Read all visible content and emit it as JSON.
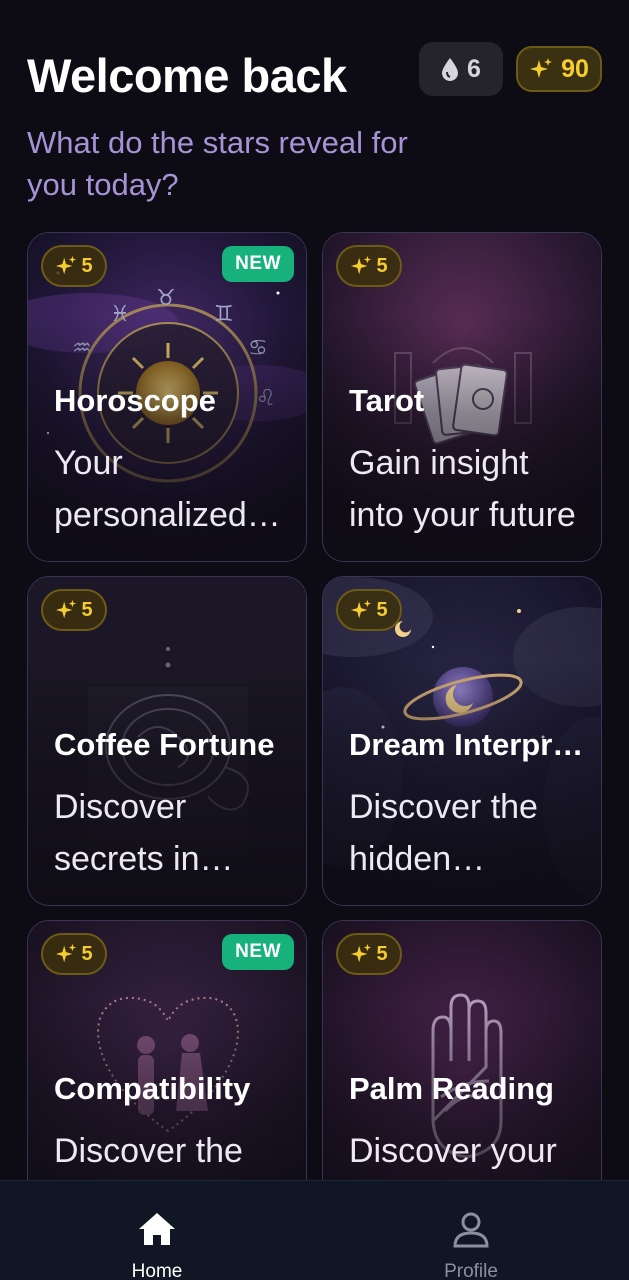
{
  "header": {
    "title": "Welcome back",
    "subtitle": "What do the stars reveal for you today?",
    "drops_count": "6",
    "stars_count": "90"
  },
  "cards": [
    {
      "title": "Horoscope",
      "description": "Your personalized horoscope",
      "cost": "5",
      "badge": "NEW",
      "icon": "zodiac-wheel-icon"
    },
    {
      "title": "Tarot",
      "description": "Gain insight into your future",
      "cost": "5",
      "badge": "",
      "icon": "tarot-cards-icon"
    },
    {
      "title": "Coffee Fortune",
      "description": "Discover secrets in Turkish coffee",
      "cost": "5",
      "badge": "",
      "icon": "coffee-cup-icon"
    },
    {
      "title": "Dream Interpretation",
      "description": "Discover the hidden meaning",
      "cost": "5",
      "badge": "",
      "icon": "crystal-ball-icon"
    },
    {
      "title": "Compatibility",
      "description": "Discover the cosmic connection",
      "cost": "5",
      "badge": "NEW",
      "icon": "couple-heart-icon"
    },
    {
      "title": "Palm Reading",
      "description": "Discover your destiny in the lines",
      "cost": "5",
      "badge": "",
      "icon": "palm-icon"
    }
  ],
  "nav": {
    "home_label": "Home",
    "profile_label": "Profile"
  },
  "colors": {
    "background": "#0d0b13",
    "accent_gold": "#f6cc2e",
    "new_badge": "#17b27c",
    "subtitle": "#a593d6"
  }
}
